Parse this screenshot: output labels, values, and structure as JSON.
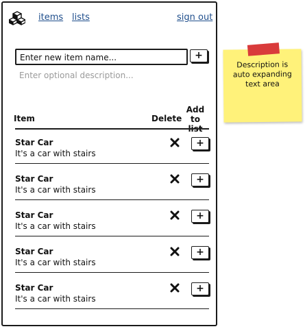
{
  "nav": {
    "items_label": "items",
    "lists_label": "lists",
    "signout_label": "sign out"
  },
  "new_item": {
    "name_placeholder": "Enter new item name...",
    "add_label": "+",
    "description_placeholder": "Enter optional description..."
  },
  "table": {
    "col_item": "Item",
    "col_delete": "Delete",
    "col_add_line1": "Add",
    "col_add_line2": "to list",
    "add_button_label": "+",
    "rows": [
      {
        "title": "Star Car",
        "description": "It's a car with stairs"
      },
      {
        "title": "Star Car",
        "description": "It's a car with stairs"
      },
      {
        "title": "Star Car",
        "description": "It's a car with stairs"
      },
      {
        "title": "Star Car",
        "description": "It's a car with stairs"
      },
      {
        "title": "Star Car",
        "description": "It's a car with stairs"
      }
    ]
  },
  "sticky_note": {
    "text": "Description is auto expanding text area",
    "note_color": "#fff27a",
    "tape_color": "#d93b3b"
  },
  "icons": {
    "logo": "cubes-logo-icon",
    "delete": "x-icon"
  }
}
